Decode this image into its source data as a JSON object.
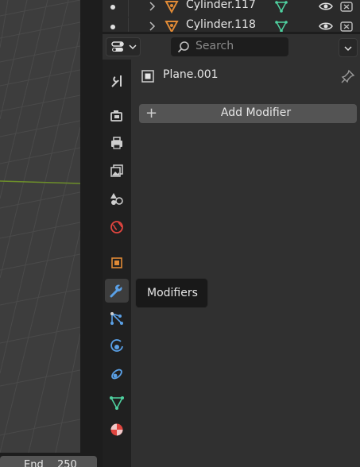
{
  "outliner": {
    "rows": [
      {
        "name": "Cylinder.117"
      },
      {
        "name": "Cylinder.118"
      }
    ]
  },
  "properties": {
    "search_placeholder": "Search",
    "object_name": "Plane.001",
    "add_modifier_label": "Add Modifier",
    "tabs": [
      "tool-tab",
      "render-tab",
      "output-tab",
      "view-layer-tab",
      "scene-tab",
      "world-tab",
      "object-tab",
      "modifiers-tab",
      "particles-tab",
      "physics-tab",
      "constraints-tab",
      "data-tab",
      "material-tab"
    ],
    "active_tab": "modifiers-tab",
    "tooltip": "Modifiers"
  },
  "timeline": {
    "end_label": "End",
    "end_value": "250"
  },
  "colors": {
    "accent_orange": "#e08a36",
    "mesh_green": "#4fd1a0",
    "modifier_blue": "#5aa0e6"
  }
}
